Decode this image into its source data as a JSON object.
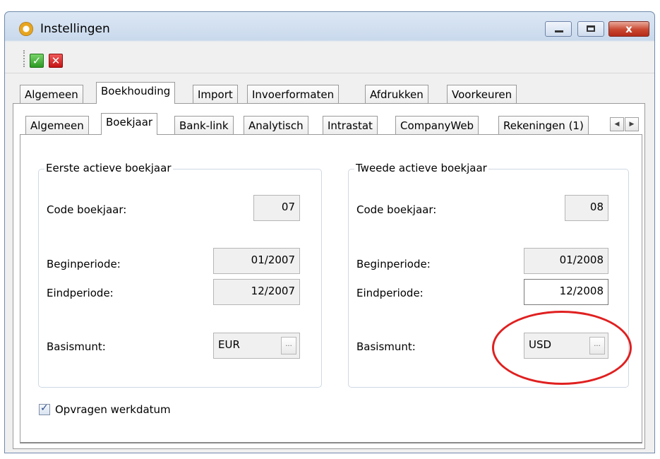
{
  "window": {
    "title": "Instellingen",
    "close_glyph": "x"
  },
  "toolbar": {
    "ok_glyph": "✓",
    "cancel_glyph": "✕"
  },
  "tabs_main": [
    "Algemeen",
    "Boekhouding",
    "Import",
    "Invoerformaten",
    "Afdrukken",
    "Voorkeuren"
  ],
  "tabs_sub": [
    "Algemeen",
    "Boekjaar",
    "Bank-link",
    "Analytisch",
    "Intrastat",
    "CompanyWeb",
    "Rekeningen (1)"
  ],
  "scroll": {
    "left": "◀",
    "right": "▶"
  },
  "first_year": {
    "legend": "Eerste actieve boekjaar",
    "code_label": "Code boekjaar:",
    "code_value": "07",
    "begin_label": "Beginperiode:",
    "begin_value": "01/2007",
    "end_label": "Eindperiode:",
    "end_value": "12/2007",
    "currency_label": "Basismunt:",
    "currency_value": "EUR"
  },
  "second_year": {
    "legend": "Tweede actieve boekjaar",
    "code_label": "Code boekjaar:",
    "code_value": "08",
    "begin_label": "Beginperiode:",
    "begin_value": "01/2008",
    "end_label": "Eindperiode:",
    "end_value": "12/2008",
    "currency_label": "Basismunt:",
    "currency_value": "USD"
  },
  "lookup_glyph": "...",
  "options": {
    "work_date_label": "Opvragen werkdatum",
    "work_date_checked": true,
    "check_glyph": "✓"
  },
  "colors": {
    "highlight": "#e02020"
  }
}
